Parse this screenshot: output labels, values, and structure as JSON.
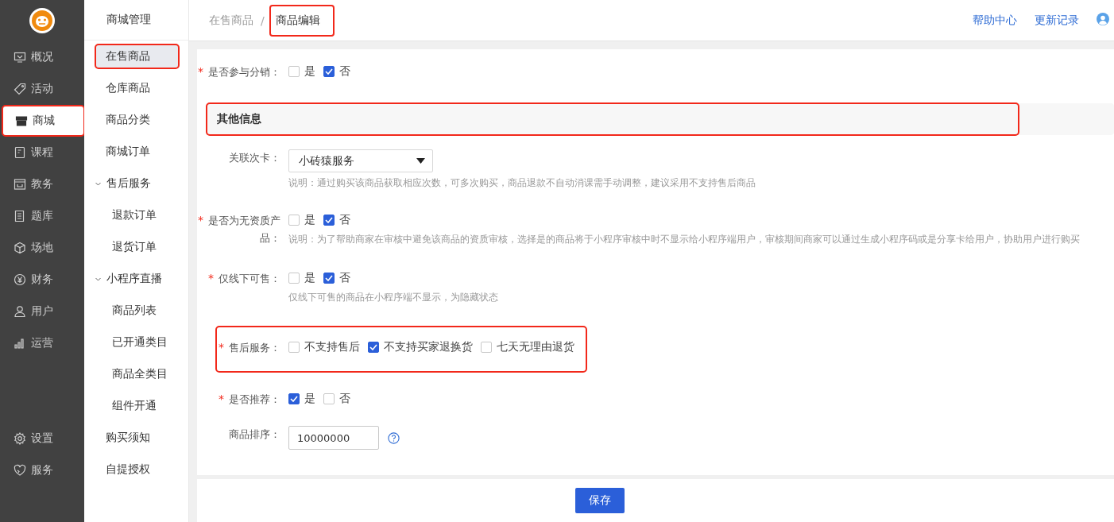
{
  "rail": {
    "items": [
      {
        "label": "概况",
        "selected": false,
        "highlighted": false
      },
      {
        "label": "活动",
        "selected": false,
        "highlighted": false
      },
      {
        "label": "商城",
        "selected": true,
        "highlighted": true
      },
      {
        "label": "课程",
        "selected": false,
        "highlighted": false
      },
      {
        "label": "教务",
        "selected": false,
        "highlighted": false
      },
      {
        "label": "题库",
        "selected": false,
        "highlighted": false
      },
      {
        "label": "场地",
        "selected": false,
        "highlighted": false
      },
      {
        "label": "财务",
        "selected": false,
        "highlighted": false
      },
      {
        "label": "用户",
        "selected": false,
        "highlighted": false
      },
      {
        "label": "运营",
        "selected": false,
        "highlighted": false
      }
    ],
    "bottom_items": [
      {
        "label": "设置",
        "selected": false,
        "highlighted": false
      },
      {
        "label": "服务",
        "selected": false,
        "highlighted": false
      }
    ]
  },
  "submenu": {
    "title": "商城管理",
    "items": [
      {
        "label": "在售商品",
        "selected": true,
        "highlighted": true
      },
      {
        "label": "仓库商品",
        "selected": false,
        "highlighted": false
      },
      {
        "label": "商品分类",
        "selected": false,
        "highlighted": false
      },
      {
        "label": "商城订单",
        "selected": false,
        "highlighted": false
      },
      {
        "label": "售后服务",
        "expanded": true,
        "children": [
          {
            "label": "退款订单",
            "selected": false,
            "highlighted": false
          },
          {
            "label": "退货订单",
            "selected": false,
            "highlighted": false
          }
        ]
      },
      {
        "label": "小程序直播",
        "expanded": true,
        "children": [
          {
            "label": "商品列表",
            "selected": false,
            "highlighted": false
          },
          {
            "label": "已开通类目",
            "selected": false,
            "highlighted": false
          },
          {
            "label": "商品全类目",
            "selected": false,
            "highlighted": false
          },
          {
            "label": "组件开通",
            "selected": false,
            "highlighted": false
          }
        ]
      },
      {
        "label": "购买须知",
        "selected": false,
        "highlighted": false
      },
      {
        "label": "自提授权",
        "selected": false,
        "highlighted": false
      }
    ]
  },
  "header": {
    "breadcrumb": [
      {
        "label": "在售商品",
        "highlighted": false
      },
      {
        "label": "商品编辑",
        "highlighted": true
      }
    ],
    "separator": "/",
    "links": [
      "帮助中心",
      "更新记录"
    ]
  },
  "form": {
    "required_mark": "*",
    "rows": [
      {
        "kind": "checkboxes",
        "required": true,
        "label": "是否参与分销：",
        "highlighted": false,
        "options": [
          {
            "label": "是",
            "checked": false
          },
          {
            "label": "否",
            "checked": true
          }
        ]
      },
      {
        "kind": "section",
        "title": "其他信息",
        "highlighted": true
      },
      {
        "kind": "select",
        "required": false,
        "label": "关联次卡：",
        "value": "小砖猿服务",
        "note": "说明：通过购买该商品获取相应次数，可多次购买，商品退款不自动消课需手动调整，建议采用不支持售后商品"
      },
      {
        "kind": "checkboxes",
        "required": true,
        "label": "是否为无资质产品：",
        "highlighted": false,
        "options": [
          {
            "label": "是",
            "checked": false
          },
          {
            "label": "否",
            "checked": true
          }
        ],
        "note": "说明：为了帮助商家在审核中避免该商品的资质审核，选择是的商品将于小程序审核中时不显示给小程序端用户，审核期间商家可以通过生成小程序码或是分享卡给用户，协助用户进行购买"
      },
      {
        "kind": "checkboxes",
        "required": true,
        "label": "仅线下可售：",
        "highlighted": false,
        "options": [
          {
            "label": "是",
            "checked": false
          },
          {
            "label": "否",
            "checked": true
          }
        ],
        "note": "仅线下可售的商品在小程序端不显示，为隐藏状态"
      },
      {
        "kind": "checkboxes",
        "required": true,
        "label": "售后服务：",
        "highlighted": true,
        "options": [
          {
            "label": "不支持售后",
            "checked": false
          },
          {
            "label": "不支持买家退换货",
            "checked": true
          },
          {
            "label": "七天无理由退货",
            "checked": false
          }
        ]
      },
      {
        "kind": "checkboxes",
        "required": true,
        "label": "是否推荐：",
        "highlighted": false,
        "options": [
          {
            "label": "是",
            "checked": true
          },
          {
            "label": "否",
            "checked": false
          }
        ]
      },
      {
        "kind": "input",
        "required": false,
        "label": "商品排序：",
        "value": "10000000"
      }
    ]
  },
  "footer": {
    "button": "保存"
  }
}
